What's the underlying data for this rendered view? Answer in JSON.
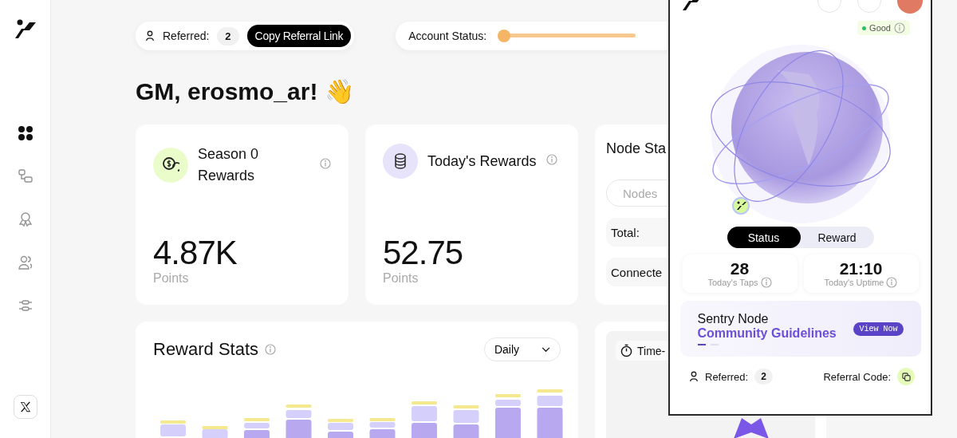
{
  "sidebar": {
    "nav_items": [
      {
        "selected": true
      },
      {
        "selected": false
      },
      {
        "selected": false
      },
      {
        "selected": false
      },
      {
        "selected": false
      }
    ]
  },
  "referral_pill": {
    "label": "Referred:",
    "count": "2",
    "button": "Copy Referral Link"
  },
  "account_status": {
    "label": "Account Status:",
    "level": 0
  },
  "greeting": "GM, erosmo_ar! 👋",
  "cards": [
    {
      "title": "Season 0 Rewards",
      "value": "4.87K",
      "unit": "Points"
    },
    {
      "title": "Today's Rewards",
      "value": "52.75",
      "unit": "Points"
    }
  ],
  "node_status": {
    "title": "Node Sta",
    "search": {
      "placeholder": "Nodes"
    },
    "rows": [
      "Total:",
      "Connecte"
    ]
  },
  "reward_stats": {
    "title": "Reward Stats",
    "period": "Daily"
  },
  "time_card": {
    "label": "Time-"
  },
  "popup": {
    "health": "Good",
    "tabs": [
      {
        "label": "Status",
        "selected": true
      },
      {
        "label": "Reward",
        "selected": false
      }
    ],
    "stats": [
      {
        "value": "28",
        "label": "Today's Taps"
      },
      {
        "value": "21:10",
        "label": "Today's Uptime"
      }
    ],
    "banner": {
      "title": "Sentry Node",
      "subtitle": "Community Guidelines",
      "button": "View Now",
      "dots": [
        {
          "selected": true
        },
        {
          "selected": false
        }
      ]
    },
    "referred": {
      "label": "Referred:",
      "count": "2"
    },
    "referral_code": {
      "label": "Referral Code:"
    }
  }
}
